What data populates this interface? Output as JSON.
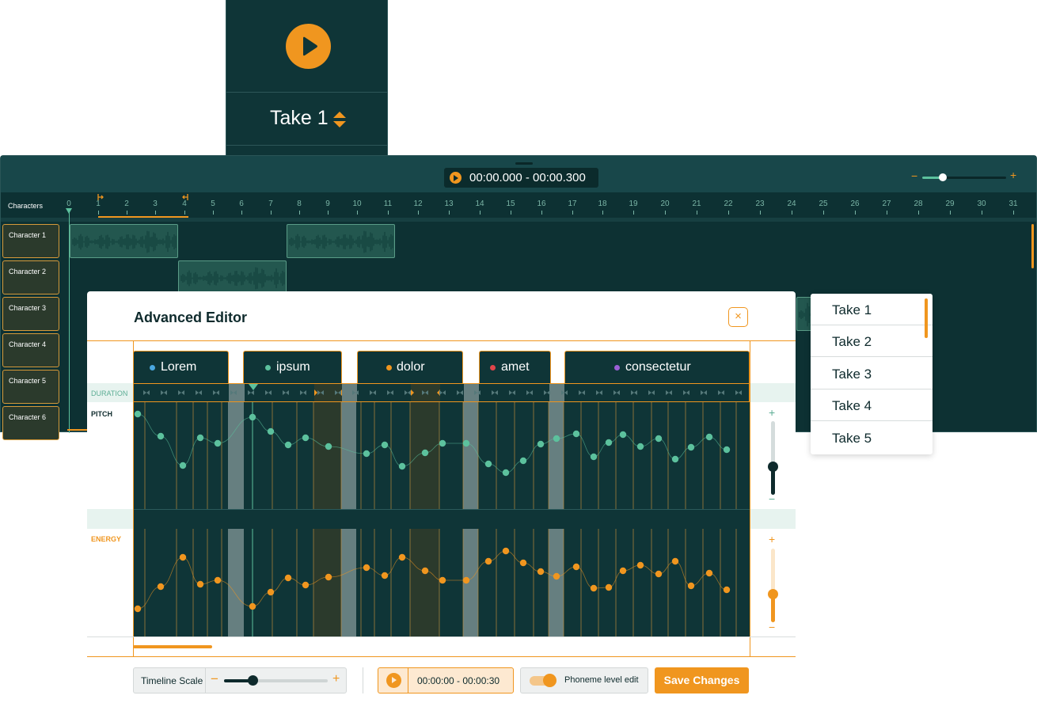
{
  "take_card": {
    "label": "Take 1",
    "icons": [
      "play-icon",
      "sort-arrows-icon"
    ]
  },
  "timeline": {
    "time_range": "00:00.000 - 00:00.300",
    "zoom": {
      "minus": "−",
      "plus": "+"
    },
    "characters_label": "Characters",
    "ticks": [
      "0",
      "1",
      "2",
      "3",
      "4",
      "5",
      "6",
      "7",
      "8",
      "9",
      "10",
      "11",
      "12",
      "13",
      "14",
      "15",
      "16",
      "17",
      "18",
      "19",
      "20",
      "21",
      "22",
      "23",
      "24",
      "25",
      "26",
      "27",
      "28",
      "29",
      "30",
      "31"
    ],
    "characters": [
      "Character 1",
      "Character 2",
      "Character 3",
      "Character 4",
      "Character 5",
      "Character 6"
    ]
  },
  "take_dropdown": {
    "options": [
      "Take 1",
      "Take 2",
      "Take 3",
      "Take 4",
      "Take 5"
    ]
  },
  "editor": {
    "title": "Advanced Editor",
    "close_label": "×",
    "words": [
      {
        "text": "Lorem",
        "color": "#4aa8e0"
      },
      {
        "text": "ipsum",
        "color": "#5cc19d"
      },
      {
        "text": "dolor",
        "color": "#f0961f"
      },
      {
        "text": "amet",
        "color": "#e0454a"
      },
      {
        "text": "consectetur",
        "color": "#9b5fd6"
      }
    ],
    "labels": {
      "duration": "DURATION",
      "pitch": "PITCH",
      "energy": "ENERGY"
    },
    "pitch_slider": {
      "plus": "+",
      "minus": "−"
    },
    "energy_slider": {
      "plus": "+",
      "minus": "−"
    }
  },
  "toolbar": {
    "timeline_scale_label": "Timeline Scale",
    "scale_minus": "−",
    "scale_plus": "+",
    "time_range": "00:00:00 - 00:00:30",
    "phoneme_label": "Phoneme level edit",
    "phoneme_enabled": true,
    "save_label": "Save Changes"
  },
  "colors": {
    "accent": "#f0961f",
    "teal_dark": "#0f3537",
    "green": "#5cc19d"
  }
}
